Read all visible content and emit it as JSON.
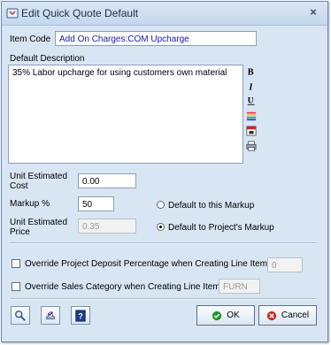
{
  "window": {
    "title": "Edit Quick Quote Default",
    "close_glyph": "×"
  },
  "item_code": {
    "label": "Item Code",
    "value": "Add On Charges:COM Upcharge"
  },
  "default_description": {
    "label": "Default Description",
    "value": "35%  Labor upcharge for using customers own material",
    "tools": [
      "bold-icon",
      "italic-icon",
      "underline-icon",
      "color-icon",
      "calendar-icon",
      "print-icon"
    ]
  },
  "unit_estimated_cost": {
    "label_line1": "Unit Estimated",
    "label_line2": "Cost",
    "value": "0.00"
  },
  "markup": {
    "label": "Markup %",
    "value": "50"
  },
  "unit_estimated_price": {
    "label_line1": "Unit Estimated",
    "label_line2": "Price",
    "value": "0.35"
  },
  "radios": {
    "default_to_this_markup": {
      "label": "Default to this Markup",
      "checked": false
    },
    "default_to_projects_markup": {
      "label": "Default to Project's Markup",
      "checked": true
    }
  },
  "override_deposit": {
    "label": "Override Project Deposit Percentage when Creating Line Item",
    "value": "0",
    "checked": false
  },
  "override_sales_category": {
    "label": "Override Sales Category when Creating Line Item",
    "value": "FURN",
    "checked": false
  },
  "footer": {
    "ok_label": "OK",
    "cancel_label": "Cancel",
    "icons": [
      "search-icon",
      "stamp-icon",
      "help-icon"
    ]
  },
  "colors": {
    "accent_blue": "#1a1aa6",
    "ok_green": "#1f9a2a",
    "cancel_red": "#c8281e"
  }
}
